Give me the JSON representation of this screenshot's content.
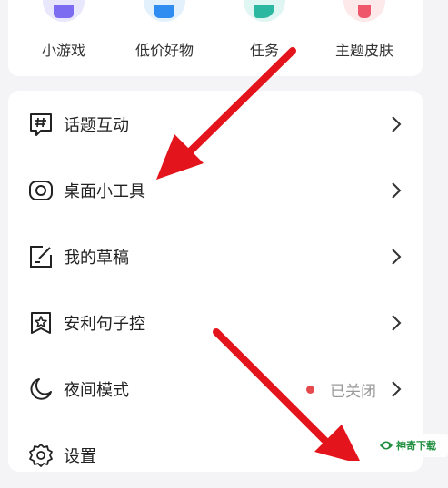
{
  "quick_actions": [
    {
      "label": "小游戏",
      "icon": "gamepad-icon",
      "bg": "#e9e7fb",
      "fg": "#7b6cf2"
    },
    {
      "label": "低价好物",
      "icon": "shopping-cart-icon",
      "bg": "#e3f1fd",
      "fg": "#2f8cf0"
    },
    {
      "label": "任务",
      "icon": "task-bubble-icon",
      "bg": "#e0f6f2",
      "fg": "#2bb8a0"
    },
    {
      "label": "主题皮肤",
      "icon": "theme-shirt-icon",
      "bg": "#fde8ea",
      "fg": "#f0566a"
    }
  ],
  "menu": {
    "items": [
      {
        "label": "话题互动",
        "icon": "hashtag-bubble-icon"
      },
      {
        "label": "桌面小工具",
        "icon": "widget-icon"
      },
      {
        "label": "我的草稿",
        "icon": "draft-edit-icon"
      },
      {
        "label": "安利句子控",
        "icon": "star-bookmark-icon"
      },
      {
        "label": "夜间模式",
        "icon": "moon-icon",
        "status": "已关闭"
      },
      {
        "label": "设置",
        "icon": "gear-icon"
      }
    ]
  },
  "colors": {
    "accent_arrow": "#e3141b",
    "status_dot": "#e5484d"
  },
  "watermark": {
    "text": "神奇下载",
    "icon": "watermark-logo-icon"
  }
}
